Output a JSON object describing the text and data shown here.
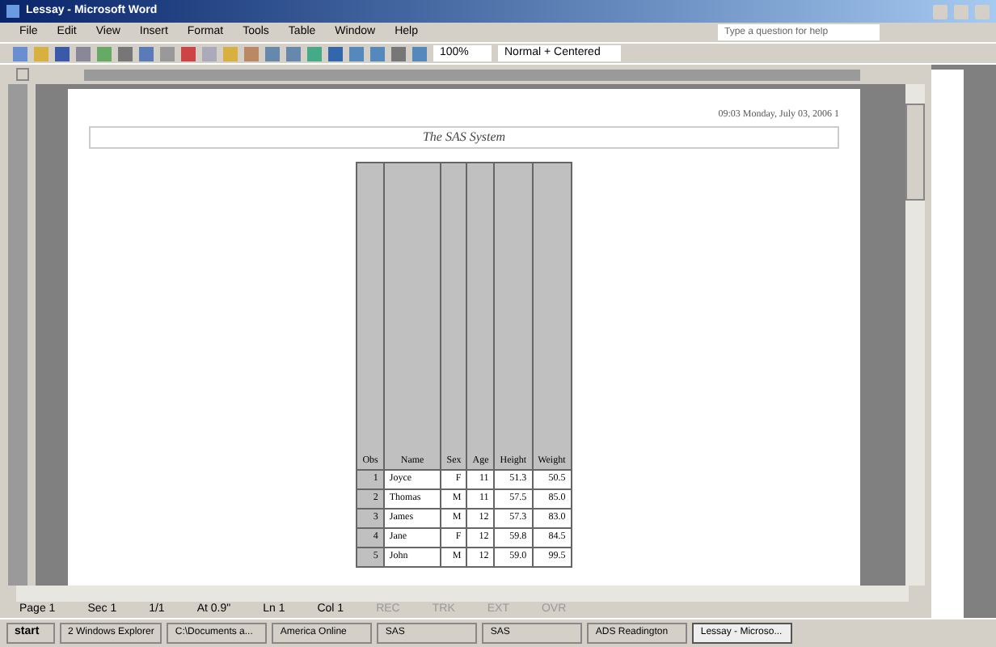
{
  "window": {
    "title": "Lessay - Microsoft Word"
  },
  "menu": [
    "File",
    "Edit",
    "View",
    "Insert",
    "Format",
    "Tools",
    "Table",
    "Window",
    "Help"
  ],
  "help_box": {
    "placeholder": "Type a question for help"
  },
  "toolbar": {
    "zoom": "100%",
    "style": "Normal + Centered"
  },
  "page": {
    "header_right": "09:03 Monday, July 03, 2006 1",
    "title": "The SAS System"
  },
  "table": {
    "columns": [
      "Obs",
      "Name",
      "Sex",
      "Age",
      "Height",
      "Weight"
    ],
    "rows": [
      [
        "1",
        "Joyce",
        "F",
        "11",
        "51.3",
        "50.5"
      ],
      [
        "2",
        "Thomas",
        "M",
        "11",
        "57.5",
        "85.0"
      ],
      [
        "3",
        "James",
        "M",
        "12",
        "57.3",
        "83.0"
      ],
      [
        "4",
        "Jane",
        "F",
        "12",
        "59.8",
        "84.5"
      ],
      [
        "5",
        "John",
        "M",
        "12",
        "59.0",
        "99.5"
      ]
    ]
  },
  "status_bar": [
    "Page 1",
    "Sec 1",
    "1/1",
    "At 0.9\"",
    "Ln 1",
    "Col 1",
    "REC",
    "TRK",
    "EXT",
    "OVR"
  ],
  "taskbar": [
    {
      "label": "start",
      "selected": false
    },
    {
      "label": "2 Windows Explorer",
      "selected": false
    },
    {
      "label": "C:\\Documents a...",
      "selected": false
    },
    {
      "label": "America Online",
      "selected": false
    },
    {
      "label": "SAS",
      "selected": false
    },
    {
      "label": "SAS",
      "selected": false
    },
    {
      "label": "ADS Readington",
      "selected": false
    },
    {
      "label": "Lessay - Microso...",
      "selected": true
    }
  ]
}
